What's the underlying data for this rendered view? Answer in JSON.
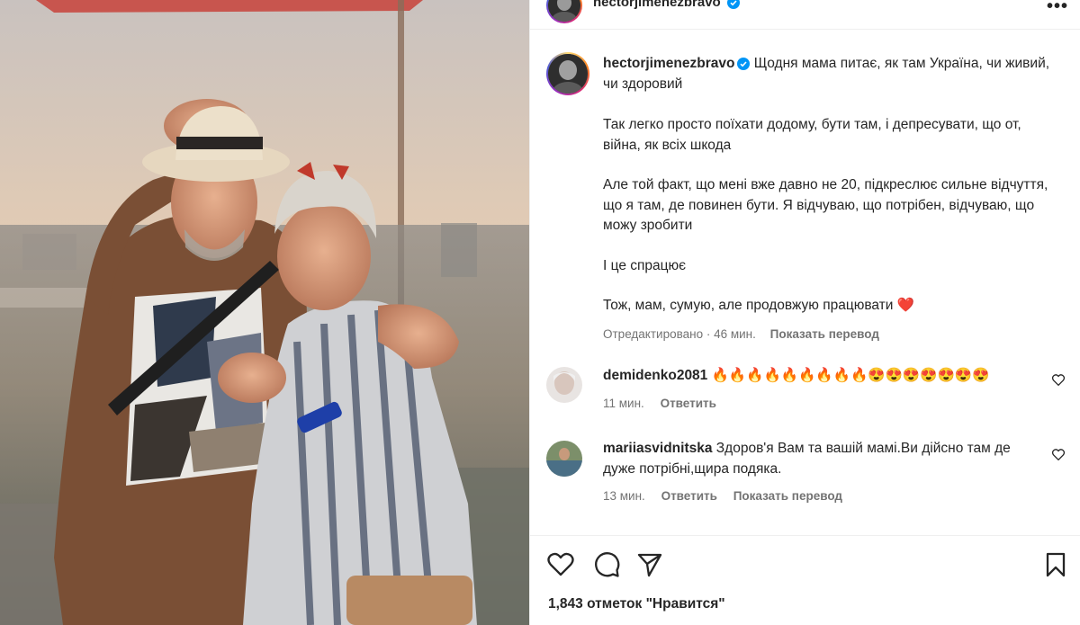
{
  "post": {
    "username": "hectorjimenezbravo",
    "caption_paragraphs": [
      "Щодня мама питає, як там Україна, чи живий, чи здоровий",
      "Так легко просто поїхати додому, бути там, і депресувати, що от, війна, як всіх шкода",
      "Але той факт, що мені вже давно не 20, підкреслює сильне відчуття, що я там, де повинен бути. Я відчуваю, що потрібен, відчуваю, що можу зробити",
      "І це спрацює",
      "Тож, мам, сумую, але продовжую працювати"
    ],
    "caption_emoji": "❤️",
    "edited_label": "Отредактировано",
    "time_label": "46 мин.",
    "translate_label": "Показать перевод",
    "likes_label": "1,843 отметок \"Нравится\""
  },
  "comments": [
    {
      "username": "demidenko2081",
      "text": "🔥🔥🔥🔥🔥🔥🔥🔥🔥😍😍😍😍😍😍😍",
      "time": "11 мин.",
      "reply_label": "Ответить"
    },
    {
      "username": "mariiasvidnitska",
      "text": "Здоров'я Вам та вашій мамі.Ви дійсно там де дуже потрібні,щира подяка.",
      "time": "13 мин.",
      "reply_label": "Ответить",
      "translate_label": "Показать перевод"
    }
  ],
  "icons": {
    "verified": "verified-badge-icon",
    "more": "more-options-icon",
    "like": "heart-outline-icon",
    "comment": "comment-bubble-icon",
    "share": "paper-plane-icon",
    "save": "bookmark-icon",
    "comment_like": "small-heart-icon"
  },
  "colors": {
    "verified_blue": "#0095f6",
    "heart_red": "#ed1c24",
    "muted_text": "#737373",
    "text": "#262626"
  }
}
